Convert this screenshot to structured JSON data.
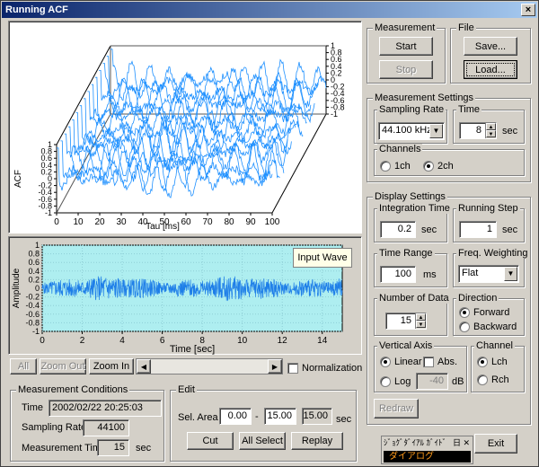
{
  "window": {
    "title": "Running ACF"
  },
  "acf_plot": {
    "y_label": "ACF",
    "x_label": "Tau [ms]",
    "x_ticks": [
      "0",
      "10",
      "20",
      "30",
      "40",
      "50",
      "60",
      "70",
      "80",
      "90",
      "100"
    ],
    "y_ticks": [
      "1",
      "0.8",
      "0.6",
      "0.4",
      "0.2",
      "0",
      "-0.2",
      "-0.4",
      "-0.6",
      "-0.8",
      "-1"
    ],
    "right_ticks": [
      "1",
      "0.8",
      "0.6",
      "0.4",
      "0.2",
      "0",
      "-0.2",
      "-0.4",
      "-0.6",
      "-0.8",
      "-1"
    ],
    "line_color": "#1e90ff"
  },
  "wave_plot": {
    "y_label": "Amplitude",
    "x_label": "Time [sec]",
    "x_ticks": [
      "0",
      "2",
      "4",
      "6",
      "8",
      "10",
      "12",
      "14"
    ],
    "y_ticks": [
      "1",
      "0.8",
      "0.6",
      "0.4",
      "0.2",
      "0",
      "-0.2",
      "-0.4",
      "-0.6",
      "-0.8",
      "-1"
    ],
    "tag": "Input Wave",
    "background": "#aeeef0",
    "line_color": "#1e7ee8"
  },
  "zoom_bar": {
    "all": "All",
    "zoom_out": "Zoom Out",
    "zoom_in": "Zoom In",
    "normalization": "Normalization"
  },
  "measurement": {
    "group": "Measurement",
    "start": "Start",
    "stop": "Stop"
  },
  "file": {
    "group": "File",
    "save": "Save...",
    "load": "Load..."
  },
  "measurement_settings": {
    "group": "Measurement Settings",
    "sampling_rate_group": "Sampling Rate",
    "sampling_rate_value": "44.100 kHz",
    "time_group": "Time",
    "time_value": "8",
    "time_unit": "sec",
    "channels_group": "Channels",
    "ch1": "1ch",
    "ch2": "2ch"
  },
  "display_settings": {
    "group": "Display Settings",
    "integration_group": "Integration Time",
    "integration_value": "0.2",
    "integration_unit": "sec",
    "running_group": "Running Step",
    "running_value": "1",
    "running_unit": "sec",
    "time_range_group": "Time Range",
    "time_range_value": "100",
    "time_range_unit": "ms",
    "freq_group": "Freq. Weighting",
    "freq_value": "Flat",
    "num_data_group": "Number of Data",
    "num_data_value": "15",
    "direction_group": "Direction",
    "forward": "Forward",
    "backward": "Backward",
    "vertical_group": "Vertical Axis",
    "linear": "Linear",
    "abs": "Abs.",
    "log": "Log",
    "log_value": "-40",
    "log_unit": "dB",
    "channel_group": "Channel",
    "lch": "Lch",
    "rch": "Rch",
    "redraw": "Redraw"
  },
  "conditions": {
    "group": "Measurement Conditions",
    "time_label": "Time",
    "time_value": "2002/02/22 20:25:03",
    "rate_label": "Sampling Rate",
    "rate_value": "44100",
    "mtime_label": "Measurement Time",
    "mtime_value": "15",
    "mtime_unit": "sec"
  },
  "edit": {
    "group": "Edit",
    "sel_area_label": "Sel. Area",
    "sel_start": "0.00",
    "sel_end": "15.00",
    "sel_len": "15.00",
    "dash": "-",
    "unit": "sec",
    "cut": "Cut",
    "all_select": "All Select",
    "replay": "Replay"
  },
  "exit": {
    "label": "Exit"
  },
  "ime_bar": {
    "title": "ｼﾞｮｸﾞﾀﾞｲｱﾙ ｶﾞｲﾄﾞ",
    "controls": "日 ✕",
    "body": "ダイアログ"
  }
}
